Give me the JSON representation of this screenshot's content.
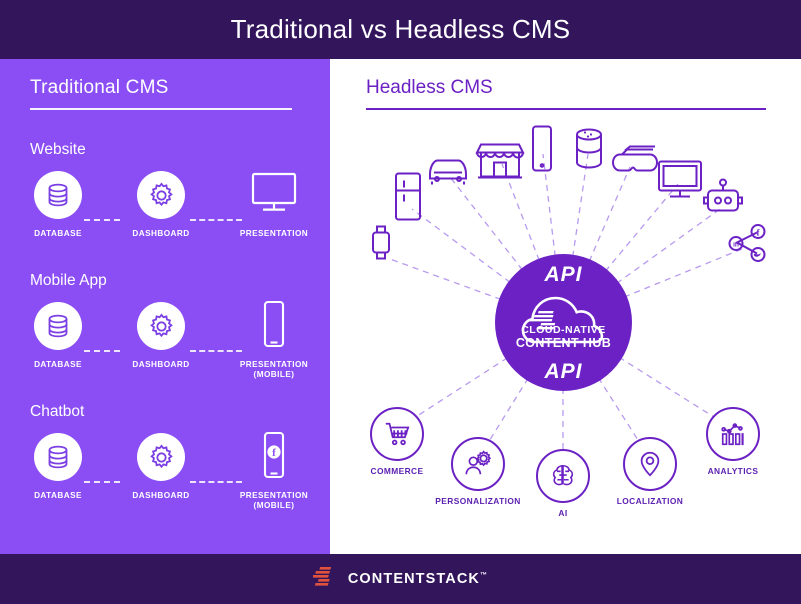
{
  "header": {
    "title": "Traditional vs Headless CMS"
  },
  "left": {
    "title": "Traditional CMS",
    "groups": [
      {
        "label": "Website",
        "nodes": [
          {
            "caption": "DATABASE",
            "icon": "database-icon"
          },
          {
            "caption": "DASHBOARD",
            "icon": "gear-icon"
          },
          {
            "caption": "PRESENTATION",
            "icon": "monitor-icon"
          }
        ]
      },
      {
        "label": "Mobile App",
        "nodes": [
          {
            "caption": "DATABASE",
            "icon": "database-icon"
          },
          {
            "caption": "DASHBOARD",
            "icon": "gear-icon"
          },
          {
            "caption": "PRESENTATION (MOBILE)",
            "icon": "smartphone-icon"
          }
        ]
      },
      {
        "label": "Chatbot",
        "nodes": [
          {
            "caption": "DATABASE",
            "icon": "database-icon"
          },
          {
            "caption": "DASHBOARD",
            "icon": "gear-icon"
          },
          {
            "caption": "PRESENTATION (MOBILE)",
            "icon": "smartphone-facebook-icon"
          }
        ]
      }
    ]
  },
  "right": {
    "title": "Headless CMS",
    "hub": {
      "api_top": "API",
      "api_bottom": "API",
      "cloud_line1": "CLOUD-NATIVE",
      "cloud_line2": "CONTENT HUB",
      "logo_icon": "contentstack-mark-icon"
    },
    "devices": [
      {
        "name": "smartwatch-icon"
      },
      {
        "name": "refrigerator-icon"
      },
      {
        "name": "car-icon"
      },
      {
        "name": "store-icon"
      },
      {
        "name": "smartphone-icon"
      },
      {
        "name": "smart-speaker-icon"
      },
      {
        "name": "vr-headset-icon"
      },
      {
        "name": "television-icon"
      },
      {
        "name": "robot-icon"
      },
      {
        "name": "social-network-icon"
      }
    ],
    "services": [
      {
        "label": "COMMERCE",
        "icon": "shopping-cart-icon"
      },
      {
        "label": "PERSONALIZATION",
        "icon": "person-gear-icon"
      },
      {
        "label": "AI",
        "icon": "brain-circuit-icon"
      },
      {
        "label": "LOCALIZATION",
        "icon": "map-pin-icon"
      },
      {
        "label": "ANALYTICS",
        "icon": "bar-chart-icon"
      }
    ]
  },
  "footer": {
    "brand": "CONTENTSTACK",
    "tm": "™",
    "logo_icon": "contentstack-logo-icon"
  },
  "colors": {
    "header_bg": "#33155C",
    "left_panel": "#8B4EF5",
    "accent_purple": "#6B21C4",
    "label_purple": "#5B1FB0",
    "logo_red": "#E1523D",
    "white": "#FFFFFF"
  }
}
